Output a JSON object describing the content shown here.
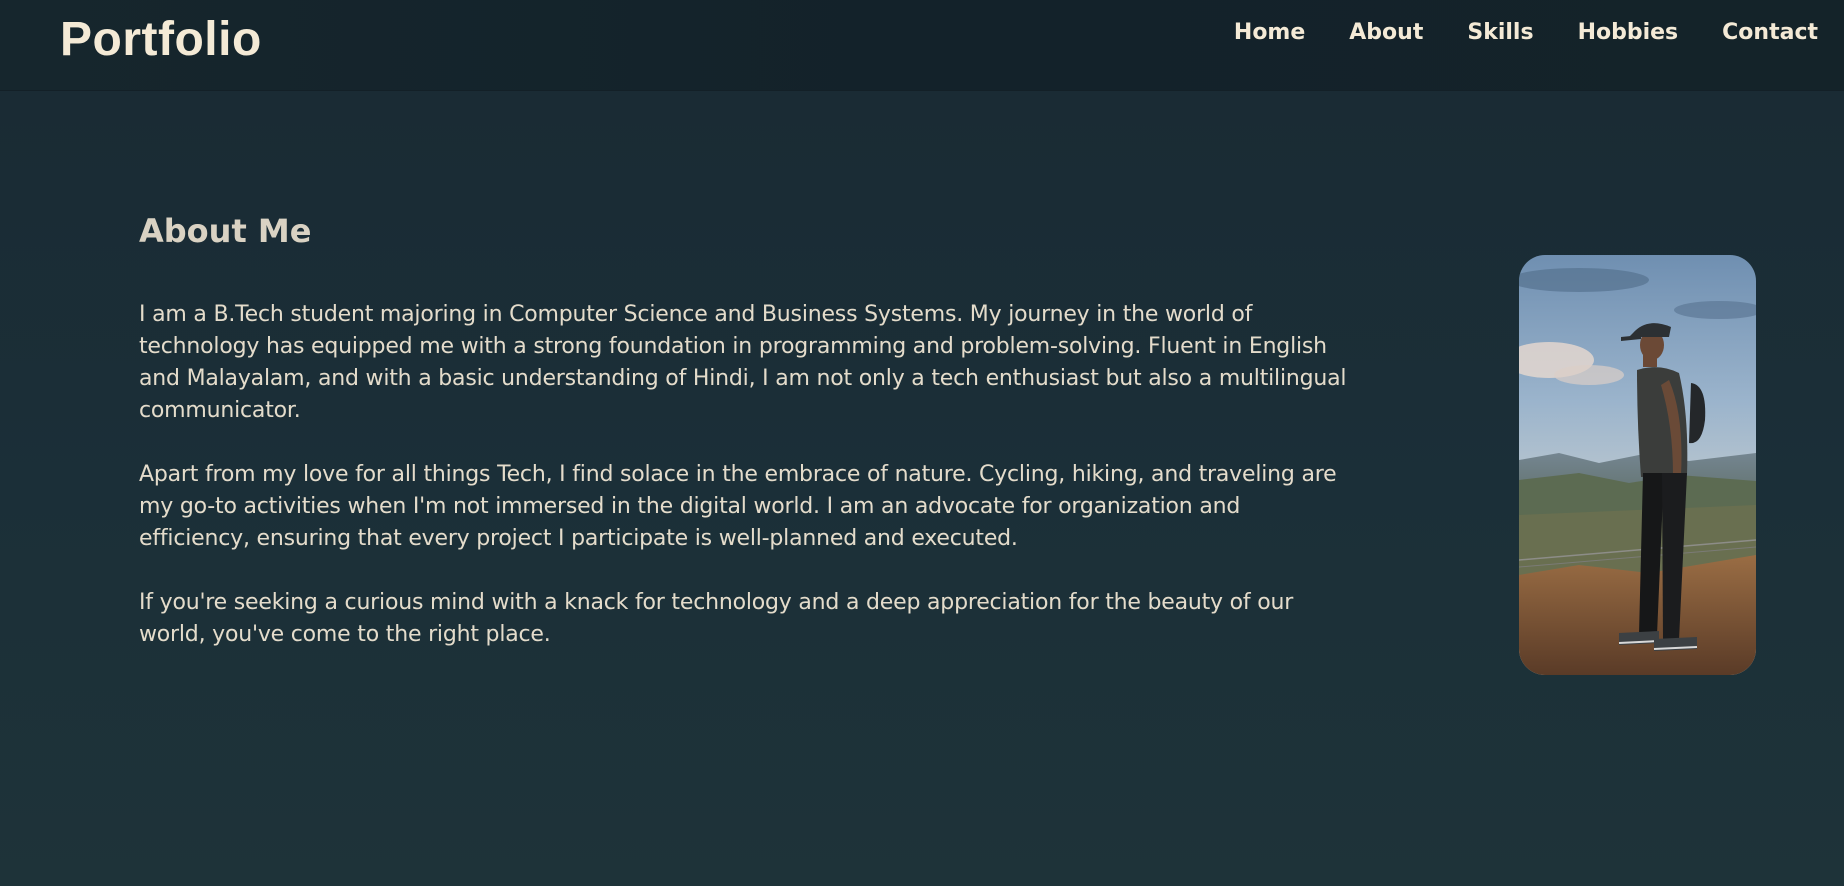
{
  "header": {
    "brand": "Portfolio",
    "nav": [
      "Home",
      "About",
      "Skills",
      "Hobbies",
      "Contact"
    ]
  },
  "about": {
    "title": "About Me",
    "paragraphs": [
      "I am a B.Tech student majoring in Computer Science and Business Systems. My journey in the world of technology has equipped me with a strong foundation in programming and problem-solving. Fluent in English and Malayalam, and with a basic understanding of Hindi, I am not only a tech enthusiast but also a multilingual communicator.",
      "Apart from my love for all things Tech, I find solace in the embrace of nature. Cycling, hiking, and traveling are my go-to activities when I'm not immersed in the digital world. I am an advocate for organization and efficiency, ensuring that every project I participate is well-planned and executed.",
      "If you're seeking a curious mind with a knack for technology and a deep appreciation for the beauty of our world, you've come to the right place."
    ]
  },
  "colors": {
    "background": "#1b2f38",
    "navbar": "#13222a",
    "text": "#f4ead6"
  }
}
